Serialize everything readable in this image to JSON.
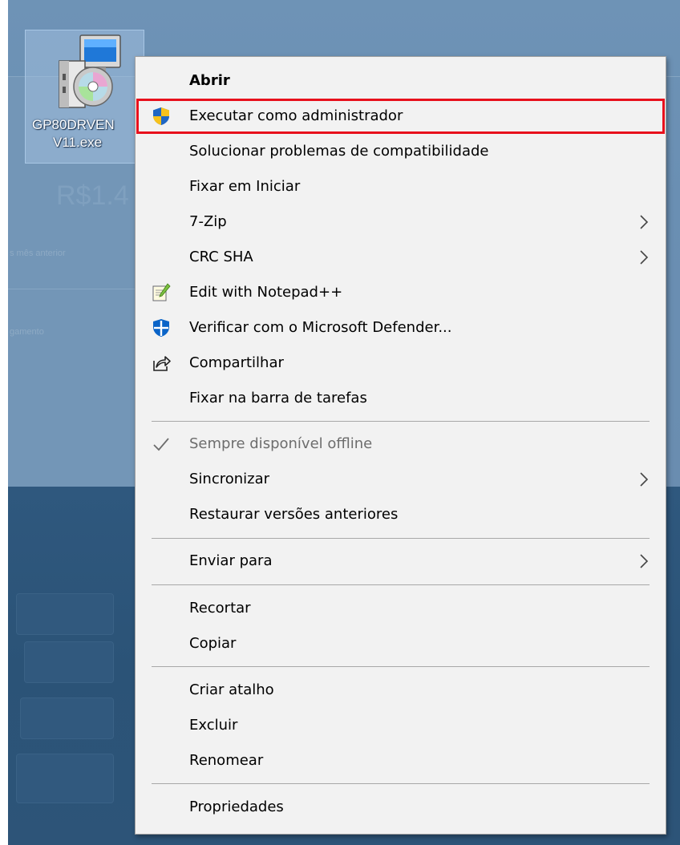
{
  "desktop": {
    "file": {
      "name_line1": "GP80DRVEN",
      "name_line2": "V11.exe",
      "icon": "installer-icon"
    },
    "background_text": {
      "amount": "R$1.4",
      "caption1": "s mês anterior",
      "caption2": "gamento"
    }
  },
  "menu": {
    "items": [
      {
        "label": "Abrir",
        "bold": true
      },
      {
        "label": "Executar como administrador",
        "icon": "uac-shield-icon",
        "highlighted": true
      },
      {
        "label": "Solucionar problemas de compatibilidade"
      },
      {
        "label": "Fixar em Iniciar"
      },
      {
        "label": "7-Zip",
        "submenu": true
      },
      {
        "label": "CRC SHA",
        "submenu": true
      },
      {
        "label": "Edit with Notepad++",
        "icon": "notepadpp-icon"
      },
      {
        "label": "Verificar com o Microsoft Defender...",
        "icon": "defender-icon"
      },
      {
        "label": "Compartilhar",
        "icon": "share-icon"
      },
      {
        "label": "Fixar na barra de tarefas"
      },
      {
        "label": "Sempre disponível offline",
        "icon": "checkmark-icon",
        "disabled": true
      },
      {
        "label": "Sincronizar",
        "submenu": true
      },
      {
        "label": "Restaurar versões anteriores"
      },
      {
        "label": "Enviar para",
        "submenu": true
      },
      {
        "label": "Recortar"
      },
      {
        "label": "Copiar"
      },
      {
        "label": "Criar atalho"
      },
      {
        "label": "Excluir"
      },
      {
        "label": "Renomear"
      },
      {
        "label": "Propriedades"
      }
    ],
    "highlight_color": "#e8101c",
    "background_color": "#f2f2f2"
  }
}
